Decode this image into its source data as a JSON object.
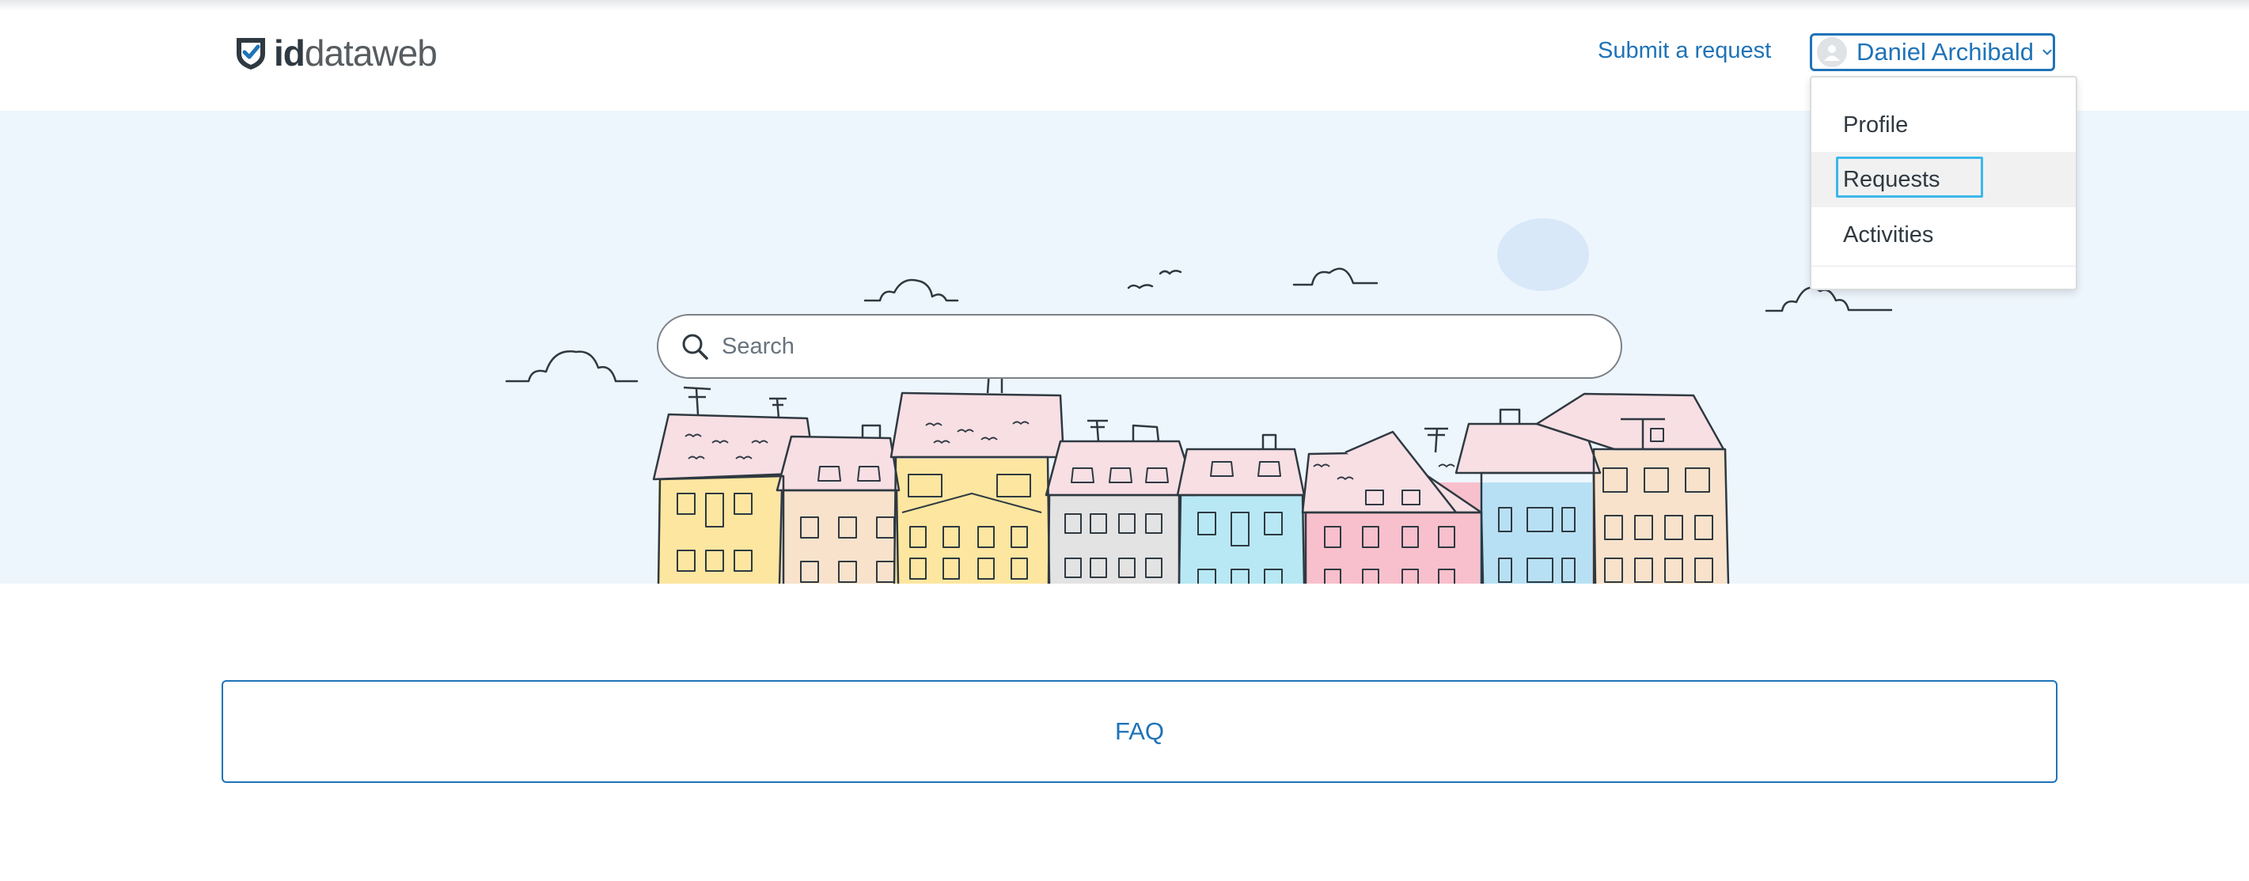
{
  "brand": {
    "logo_bold": "id",
    "logo_light": "dataweb"
  },
  "header": {
    "submit_request": "Submit a request"
  },
  "user_menu": {
    "name": "Daniel Archibald",
    "items": [
      {
        "label": "Profile"
      },
      {
        "label": "Requests",
        "active": true
      },
      {
        "label": "Activities"
      }
    ]
  },
  "search": {
    "placeholder": "Search",
    "value": ""
  },
  "faq": {
    "label": "FAQ"
  },
  "colors": {
    "accent": "#1f73b7",
    "focus_ring": "#3cb8ec",
    "hero_bg": "#eef6fd"
  }
}
